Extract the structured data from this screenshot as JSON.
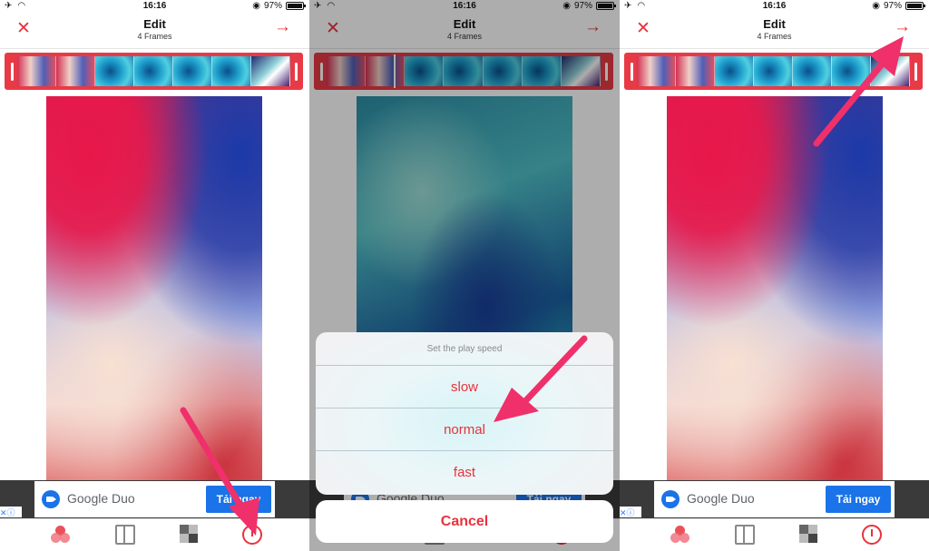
{
  "status": {
    "time": "16:16",
    "battery": "97%"
  },
  "nav": {
    "title": "Edit",
    "subtitle": "4 Frames",
    "close_icon": "close-icon",
    "next_icon": "arrow-right-icon"
  },
  "ad": {
    "brand": "Google Duo",
    "cta": "Tải ngay",
    "cta_partial": "T",
    "cta_partial2": "Tải ngay"
  },
  "speed_sheet": {
    "title": "Set the play speed",
    "options": [
      "slow",
      "normal",
      "fast"
    ],
    "cancel": "Cancel"
  },
  "tabs": [
    "colors-icon",
    "layout-icon",
    "frames-icon",
    "speed-icon"
  ],
  "colors": {
    "accent": "#e8323c",
    "arrow": "#f0306a",
    "ad_button": "#1a73e8"
  }
}
